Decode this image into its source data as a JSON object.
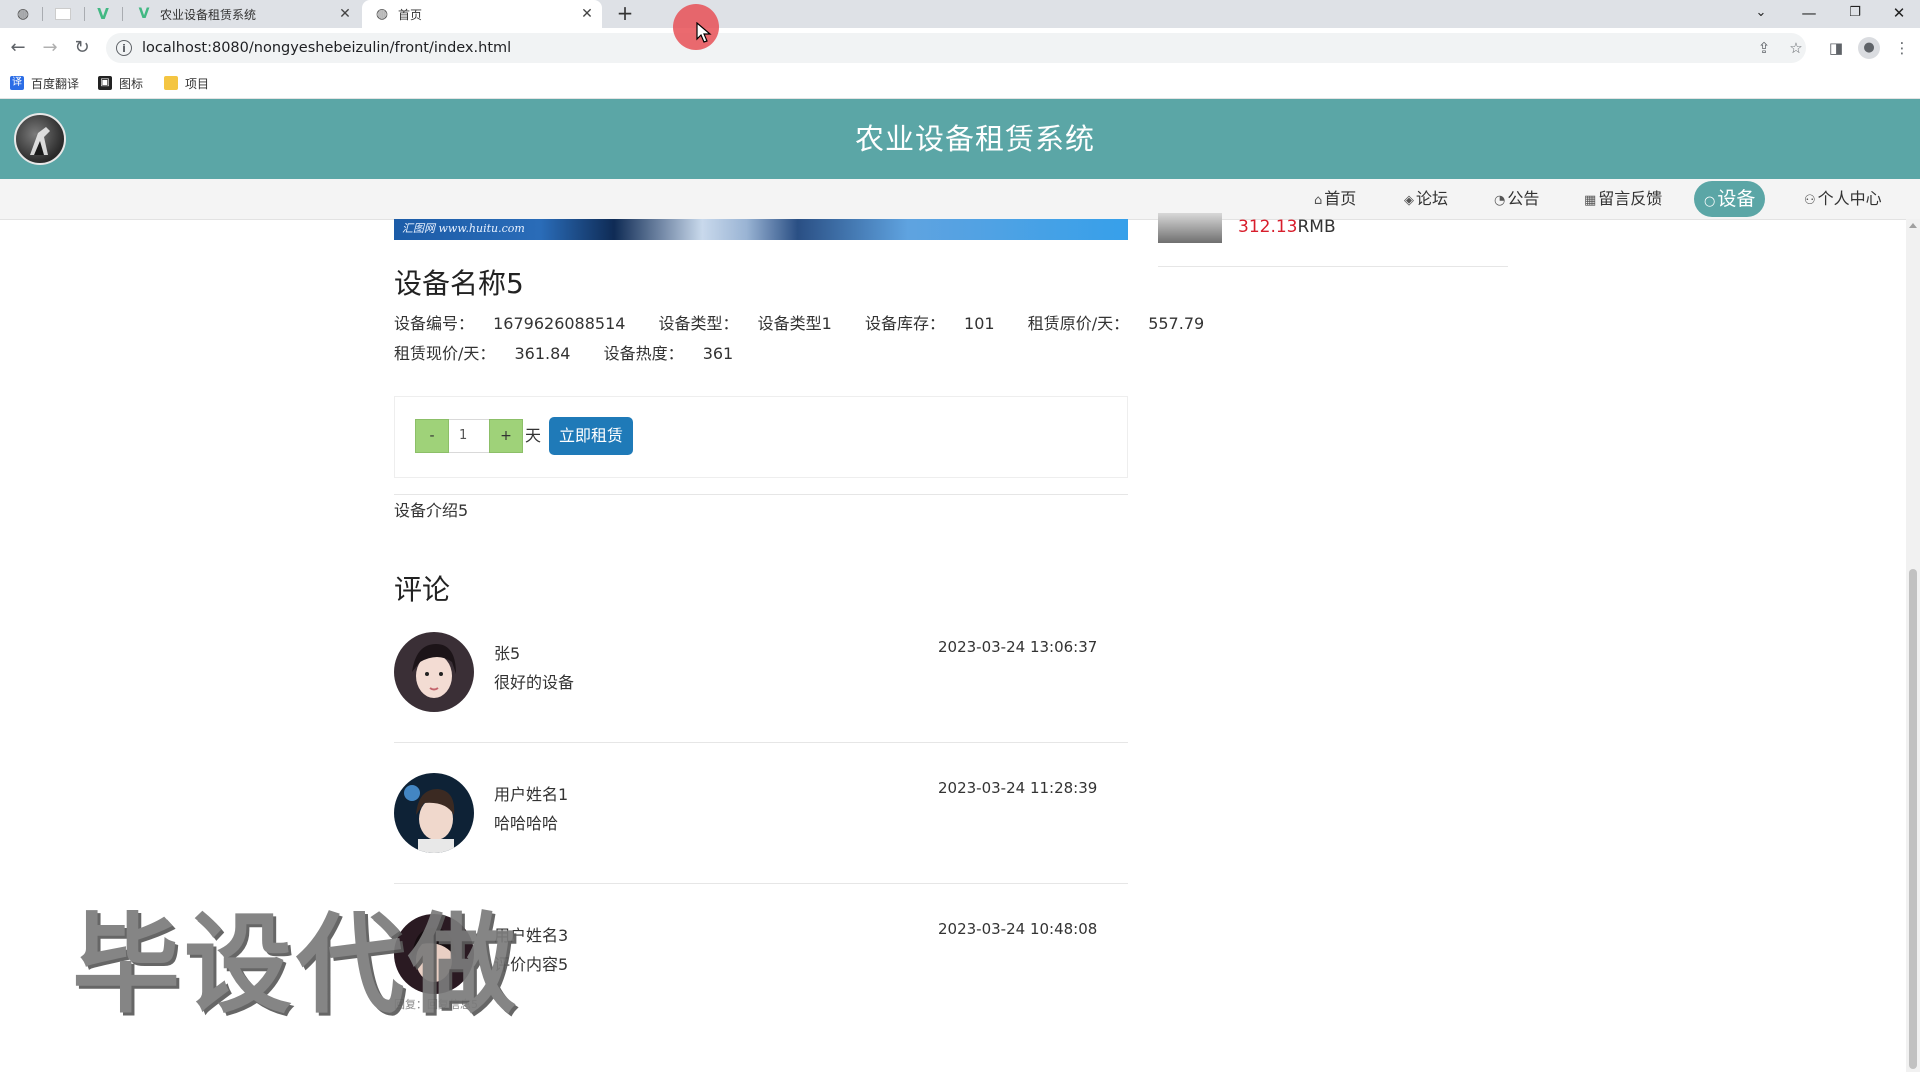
{
  "browser": {
    "tabs": [
      {
        "title": "农业设备租赁系统",
        "active": false
      },
      {
        "title": "首页",
        "active": true
      }
    ],
    "url": "localhost:8080/nongyeshebeizulin/front/index.html",
    "bookmarks": [
      {
        "label": "百度翻译",
        "icon": "baidu-translate-icon"
      },
      {
        "label": "图标",
        "icon": "image-icon"
      },
      {
        "label": "项目",
        "icon": "folder-icon"
      }
    ]
  },
  "site": {
    "title": "农业设备租赁系统",
    "nav": [
      {
        "label": "首页",
        "icon": "home-icon",
        "active": false
      },
      {
        "label": "论坛",
        "icon": "layers-icon",
        "active": false
      },
      {
        "label": "公告",
        "icon": "speedometer-icon",
        "active": false
      },
      {
        "label": "留言反馈",
        "icon": "message-icon",
        "active": false
      },
      {
        "label": "设备",
        "icon": "circle-icon",
        "active": true
      },
      {
        "label": "个人中心",
        "icon": "user-icon",
        "active": false
      }
    ],
    "accent_color": "#5ba6a6"
  },
  "product": {
    "banner_watermark": "汇图网 www.huitu.com",
    "name": "设备名称5",
    "attrs_line1": [
      {
        "label": "设备编号：",
        "value": "1679626088514"
      },
      {
        "label": "设备类型：",
        "value": "设备类型1"
      },
      {
        "label": "设备库存：",
        "value": "101"
      },
      {
        "label": "租赁原价/天：",
        "value": "557.79"
      }
    ],
    "attrs_line2": [
      {
        "label": "租赁现价/天：",
        "value": "361.84"
      },
      {
        "label": "设备热度：",
        "value": "361"
      }
    ],
    "days": {
      "minus": "-",
      "value": "1",
      "plus": "+",
      "unit": "天"
    },
    "rent_button": "立即租赁",
    "description": "设备介绍5"
  },
  "sidebar": {
    "price_value": "312.13",
    "price_unit": "RMB"
  },
  "comments": {
    "title": "评论",
    "items": [
      {
        "user": "张5",
        "text": "很好的设备",
        "time": "2023-03-24 13:06:37"
      },
      {
        "user": "用户姓名1",
        "text": "哈哈哈哈",
        "time": "2023-03-24 11:28:39"
      },
      {
        "user": "用户姓名3",
        "text": "评价内容5",
        "time": "2023-03-24 10:48:08"
      }
    ],
    "reply": "回复：回复信息5"
  },
  "overlay": {
    "watermark": "毕设代做"
  }
}
